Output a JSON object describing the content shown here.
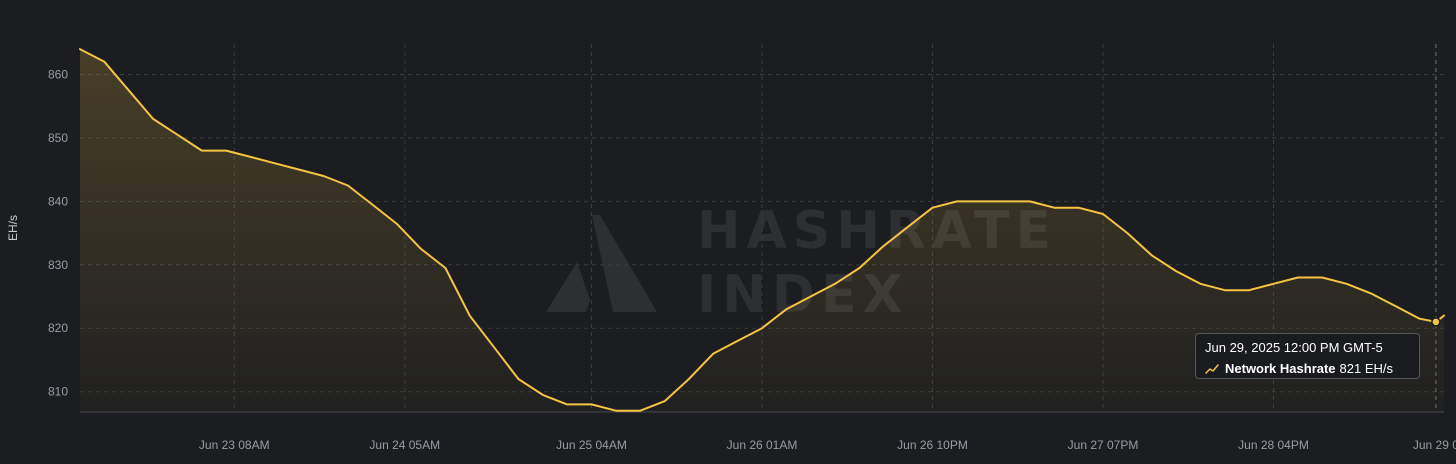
{
  "colors": {
    "background": "#1c1d20",
    "line": "#f4c542",
    "grid": "#3a3b3f",
    "tick_text": "#9a9ca3",
    "watermark": "#2e2f33"
  },
  "watermark": {
    "line1": "HASHRATE",
    "line2": "INDEX"
  },
  "tooltip": {
    "date": "Jun 29, 2025 12:00 PM GMT-5",
    "series_icon": "line-chart-icon",
    "series_name": "Network Hashrate",
    "value": "821 EH/s"
  },
  "chart_data": {
    "type": "area",
    "title": "",
    "xlabel": "",
    "ylabel": "EH/s",
    "grid": true,
    "legend": "none",
    "ylim": [
      806.8,
      864.8
    ],
    "y_ticks": [
      810,
      820,
      830,
      840,
      850,
      860
    ],
    "xlim": [
      "2025-06-22 13:00",
      "2025-06-29 13:00"
    ],
    "x_ticks": [
      {
        "label": "Jun 23 08AM",
        "x": "2025-06-23 08:00"
      },
      {
        "label": "Jun 24 05AM",
        "x": "2025-06-24 05:00"
      },
      {
        "label": "Jun 25 04AM",
        "x": "2025-06-25 04:00"
      },
      {
        "label": "Jun 26 01AM",
        "x": "2025-06-26 01:00"
      },
      {
        "label": "Jun 26 10PM",
        "x": "2025-06-26 22:00"
      },
      {
        "label": "Jun 27 07PM",
        "x": "2025-06-27 19:00"
      },
      {
        "label": "Jun 28 04PM",
        "x": "2025-06-28 16:00"
      },
      {
        "label": "Jun 29 0",
        "x": "2025-06-29 12:00"
      }
    ],
    "series": [
      {
        "x": [
          "2025-06-22 13:00",
          "2025-06-22 16:00",
          "2025-06-22 19:00",
          "2025-06-22 22:00",
          "2025-06-23 01:00",
          "2025-06-23 04:00",
          "2025-06-23 07:00",
          "2025-06-23 10:00",
          "2025-06-23 13:00",
          "2025-06-23 16:00",
          "2025-06-23 19:00",
          "2025-06-23 22:00",
          "2025-06-24 01:00",
          "2025-06-24 04:00",
          "2025-06-24 07:00",
          "2025-06-24 10:00",
          "2025-06-24 13:00",
          "2025-06-24 16:00",
          "2025-06-24 19:00",
          "2025-06-24 22:00",
          "2025-06-25 01:00",
          "2025-06-25 04:00",
          "2025-06-25 07:00",
          "2025-06-25 10:00",
          "2025-06-25 13:00",
          "2025-06-25 16:00",
          "2025-06-25 19:00",
          "2025-06-25 22:00",
          "2025-06-26 01:00",
          "2025-06-26 04:00",
          "2025-06-26 07:00",
          "2025-06-26 10:00",
          "2025-06-26 13:00",
          "2025-06-26 16:00",
          "2025-06-26 19:00",
          "2025-06-26 22:00",
          "2025-06-27 01:00",
          "2025-06-27 04:00",
          "2025-06-27 07:00",
          "2025-06-27 10:00",
          "2025-06-27 13:00",
          "2025-06-27 16:00",
          "2025-06-27 19:00",
          "2025-06-27 22:00",
          "2025-06-28 01:00",
          "2025-06-28 04:00",
          "2025-06-28 07:00",
          "2025-06-28 10:00",
          "2025-06-28 13:00",
          "2025-06-28 16:00",
          "2025-06-28 19:00",
          "2025-06-28 22:00",
          "2025-06-29 01:00",
          "2025-06-29 04:00",
          "2025-06-29 07:00",
          "2025-06-29 10:00",
          "2025-06-29 12:00",
          "2025-06-29 13:00"
        ],
        "values": [
          864,
          862,
          857.5,
          853,
          850.5,
          848,
          848,
          847,
          846,
          845,
          844,
          842.5,
          839.5,
          836.5,
          832.5,
          829.5,
          822,
          817,
          812,
          809.5,
          808,
          808,
          807,
          807,
          808.5,
          812,
          816,
          818,
          820,
          823,
          825,
          827,
          829.5,
          833,
          836,
          839,
          840,
          840,
          840,
          840,
          839,
          839,
          838,
          835,
          831.5,
          829,
          827,
          826,
          826,
          827,
          828,
          828,
          827,
          825.5,
          823.5,
          821.5,
          821,
          822
        ]
      }
    ],
    "highlight": {
      "x": "2025-06-29 12:00",
      "value": 821
    }
  }
}
